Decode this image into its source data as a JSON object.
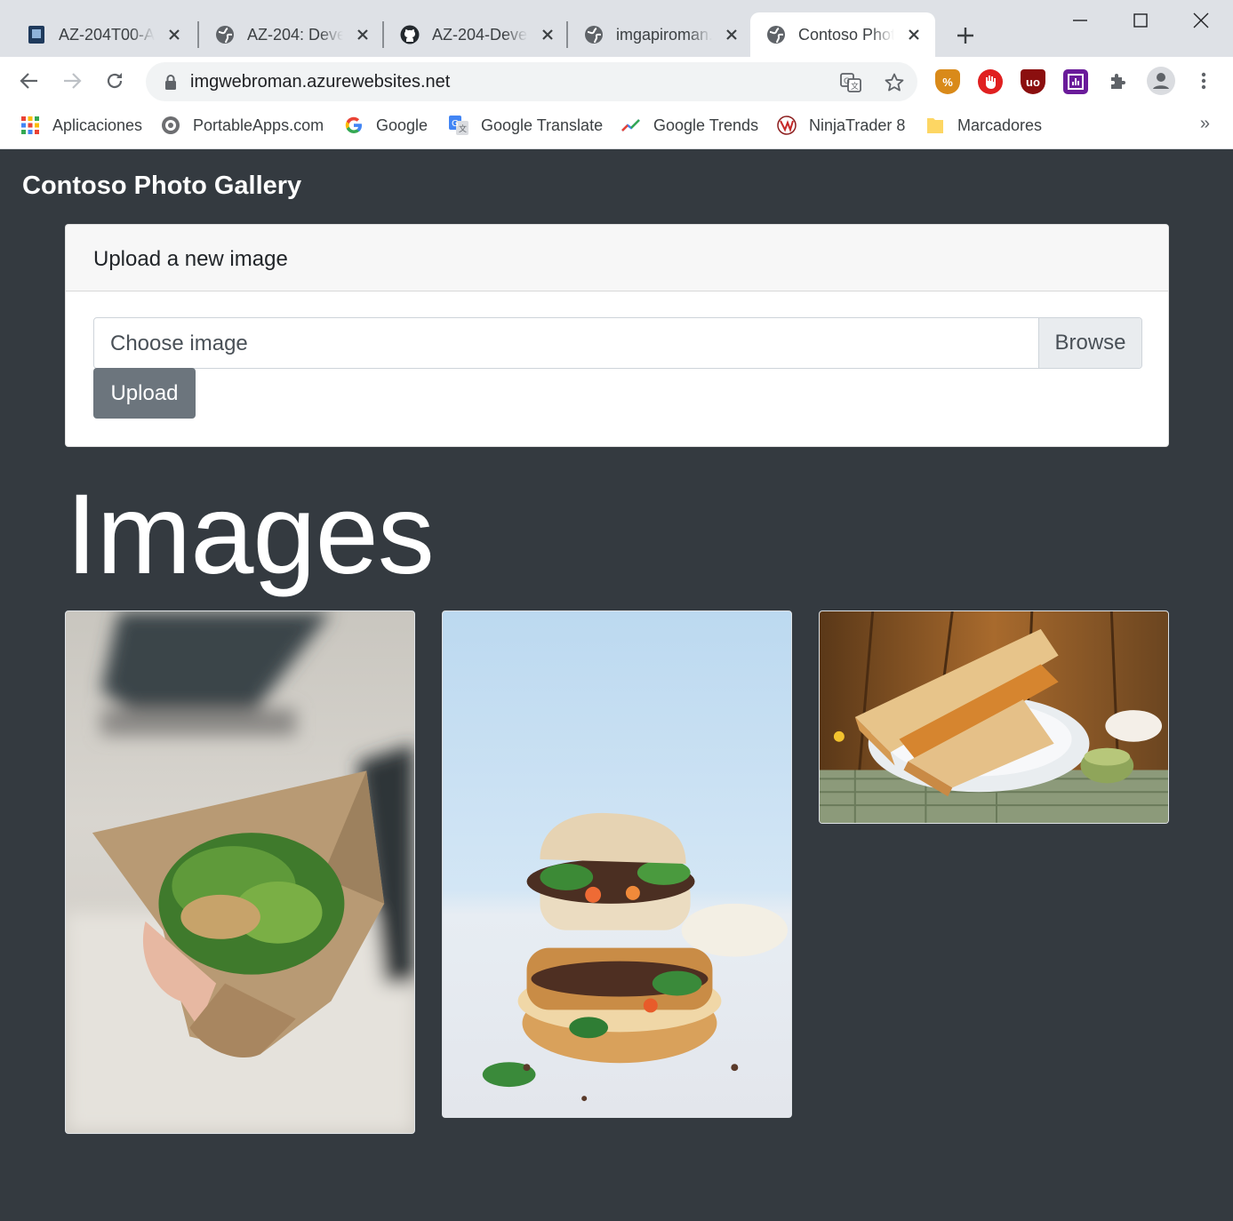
{
  "browser": {
    "tabs": [
      {
        "title": "AZ-204T00-A"
      },
      {
        "title": "AZ-204: Devel"
      },
      {
        "title": "AZ-204-Devel"
      },
      {
        "title": "imgapiroman."
      },
      {
        "title": "Contoso Phot"
      }
    ],
    "url": "imgwebroman.azurewebsites.net",
    "bookmarks": [
      {
        "label": "Aplicaciones"
      },
      {
        "label": "PortableApps.com"
      },
      {
        "label": "Google"
      },
      {
        "label": "Google Translate"
      },
      {
        "label": "Google Trends"
      },
      {
        "label": "NinjaTrader 8"
      },
      {
        "label": "Marcadores"
      }
    ],
    "bookmarks_overflow": "»"
  },
  "page": {
    "brand": "Contoso Photo Gallery",
    "upload_card": {
      "header": "Upload a new image",
      "file_placeholder": "Choose image",
      "browse_label": "Browse",
      "upload_label": "Upload"
    },
    "images_heading": "Images"
  },
  "colors": {
    "page_bg": "#343a40",
    "upload_button": "#6c757d",
    "card_header_bg": "#f7f7f7"
  }
}
